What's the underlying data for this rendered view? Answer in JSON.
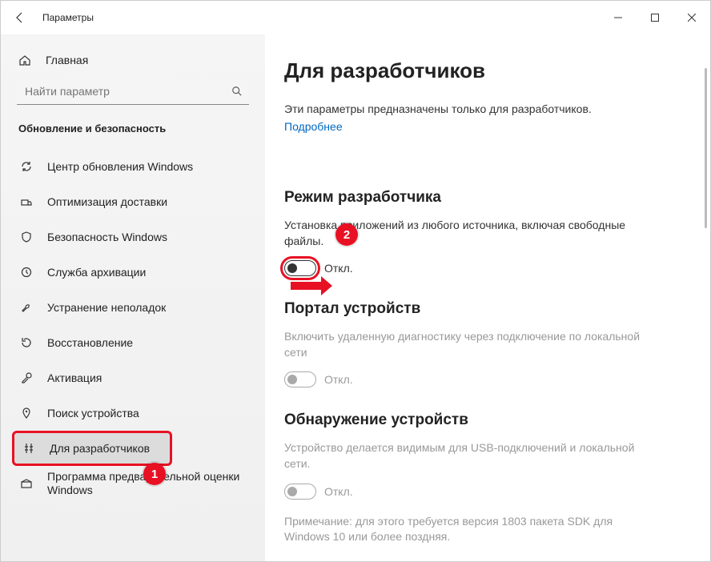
{
  "window": {
    "title": "Параметры"
  },
  "sidebar": {
    "home": "Главная",
    "search_placeholder": "Найти параметр",
    "category": "Обновление и безопасность",
    "items": [
      {
        "label": "Центр обновления Windows"
      },
      {
        "label": "Оптимизация доставки"
      },
      {
        "label": "Безопасность Windows"
      },
      {
        "label": "Служба архивации"
      },
      {
        "label": "Устранение неполадок"
      },
      {
        "label": "Восстановление"
      },
      {
        "label": "Активация"
      },
      {
        "label": "Поиск устройства"
      },
      {
        "label": "Для разработчиков"
      },
      {
        "label": "Программа предварительной оценки Windows"
      }
    ]
  },
  "main": {
    "title": "Для разработчиков",
    "intro": "Эти параметры предназначены только для разработчиков.",
    "learn_more": "Подробнее",
    "sections": {
      "dev_mode": {
        "title": "Режим разработчика",
        "desc": "Установка приложений из любого источника, включая свободные файлы.",
        "toggle_label": "Откл."
      },
      "device_portal": {
        "title": "Портал устройств",
        "desc": "Включить удаленную диагностику через подключение по локальной сети",
        "toggle_label": "Откл."
      },
      "device_discovery": {
        "title": "Обнаружение устройств",
        "desc": "Устройство делается видимым для USB-подключений и локальной сети.",
        "toggle_label": "Откл.",
        "note": "Примечание: для этого требуется версия 1803 пакета SDK для Windows 10 или более поздняя."
      }
    }
  },
  "callouts": {
    "one": "1",
    "two": "2"
  }
}
